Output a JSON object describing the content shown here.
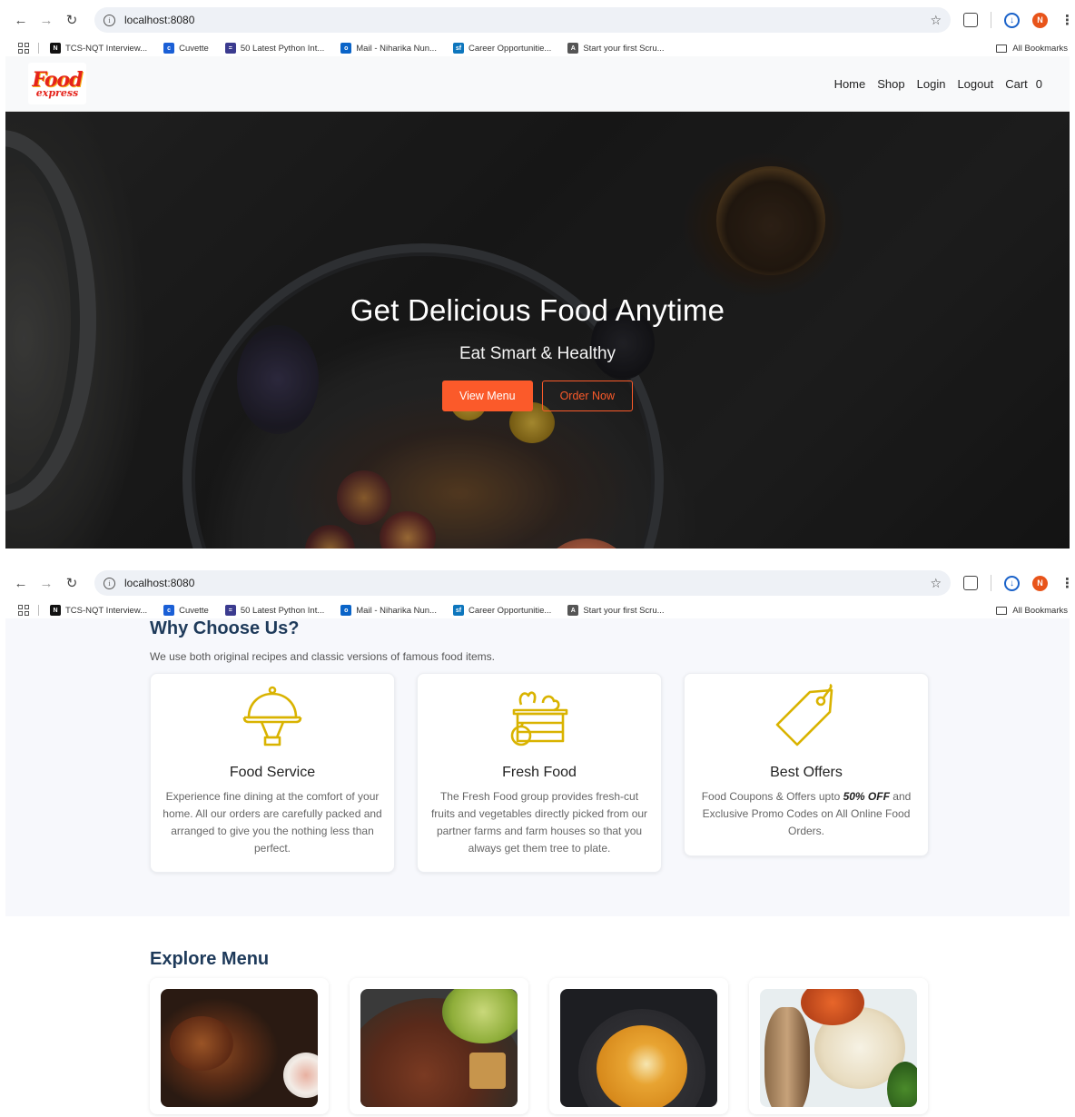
{
  "browser": {
    "url": "localhost:8080",
    "bookmarks": [
      {
        "label": "TCS-NQT Interview...",
        "icon": "notion-icon",
        "color": "#111111"
      },
      {
        "label": "Cuvette",
        "icon": "cuvette-icon",
        "color": "#1a5fd6"
      },
      {
        "label": "50 Latest Python Int...",
        "icon": "site-icon",
        "color": "#3b3b8f"
      },
      {
        "label": "Mail - Niharika Nun...",
        "icon": "outlook-icon",
        "color": "#0a64c8"
      },
      {
        "label": "Career Opportunitie...",
        "icon": "sf-icon",
        "color": "#0d76bd"
      },
      {
        "label": "Start your first Scru...",
        "icon": "scrum-icon",
        "color": "#555555"
      }
    ],
    "all_bookmarks": "All Bookmarks",
    "profile_initial": "N"
  },
  "site": {
    "logo_top": "Food",
    "logo_bottom": "express",
    "nav": {
      "home": "Home",
      "shop": "Shop",
      "login": "Login",
      "logout": "Logout",
      "cart": "Cart",
      "cart_count": "0"
    }
  },
  "hero": {
    "title": "Get Delicious Food Anytime",
    "subtitle": "Eat Smart & Healthy",
    "primary_button": "View Menu",
    "secondary_button": "Order Now"
  },
  "why": {
    "title": "Why Choose Us?",
    "subtitle": "We use both original recipes and classic versions of famous food items.",
    "cards": [
      {
        "title": "Food Service",
        "icon": "cloche-icon",
        "text": "Experience fine dining at the comfort of your home. All our orders are carefully packed and arranged to give you the nothing less than perfect."
      },
      {
        "title": "Fresh Food",
        "icon": "fresh-basket-icon",
        "text": "The Fresh Food group provides fresh-cut fruits and vegetables directly picked from our partner farms and farm houses so that you always get them tree to plate."
      },
      {
        "title": "Best Offers",
        "icon": "price-tag-icon",
        "text_before": "Food Coupons & Offers upto ",
        "text_bold": "50% OFF",
        "text_after": " and Exclusive Promo Codes on All Online Food Orders."
      }
    ]
  },
  "explore": {
    "title": "Explore Menu"
  },
  "colors": {
    "accent": "#fb5a2a",
    "heading": "#1e3a5a",
    "icon_gold": "#d9b300"
  }
}
